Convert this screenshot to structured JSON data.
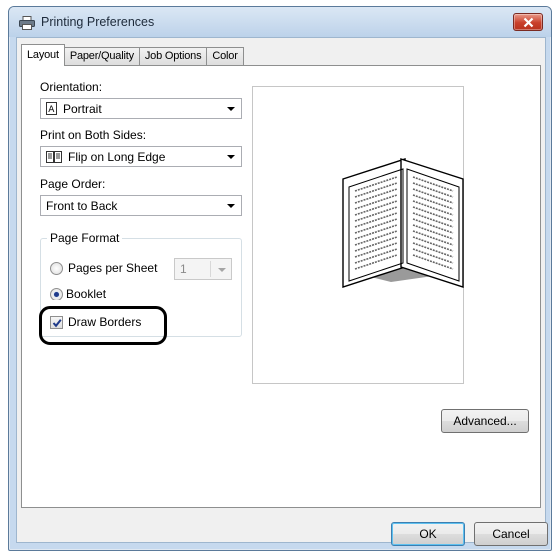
{
  "window": {
    "title": "Printing Preferences"
  },
  "tabs": [
    {
      "label": "Layout",
      "active": true
    },
    {
      "label": "Paper/Quality",
      "active": false
    },
    {
      "label": "Job Options",
      "active": false
    },
    {
      "label": "Color",
      "active": false
    }
  ],
  "layout": {
    "orientation": {
      "label": "Orientation:",
      "value": "Portrait",
      "icon": "portrait-page-icon"
    },
    "duplex": {
      "label": "Print on Both Sides:",
      "value": "Flip on Long Edge",
      "icon": "flip-long-edge-icon"
    },
    "page_order": {
      "label": "Page Order:",
      "value": "Front to Back"
    },
    "page_format": {
      "title": "Page Format",
      "pages_per_sheet": {
        "label": "Pages per Sheet",
        "selected": false,
        "count": "1",
        "enabled": false
      },
      "booklet": {
        "label": "Booklet",
        "selected": true
      },
      "draw_borders": {
        "label": "Draw Borders",
        "checked": true
      }
    },
    "preview_icon": "booklet-preview-icon"
  },
  "buttons": {
    "advanced": "Advanced...",
    "ok": "OK",
    "cancel": "Cancel"
  },
  "colors": {
    "title_bar": "#c6d9ee",
    "close_button": "#c9402b",
    "highlight_ring": "#000000"
  }
}
